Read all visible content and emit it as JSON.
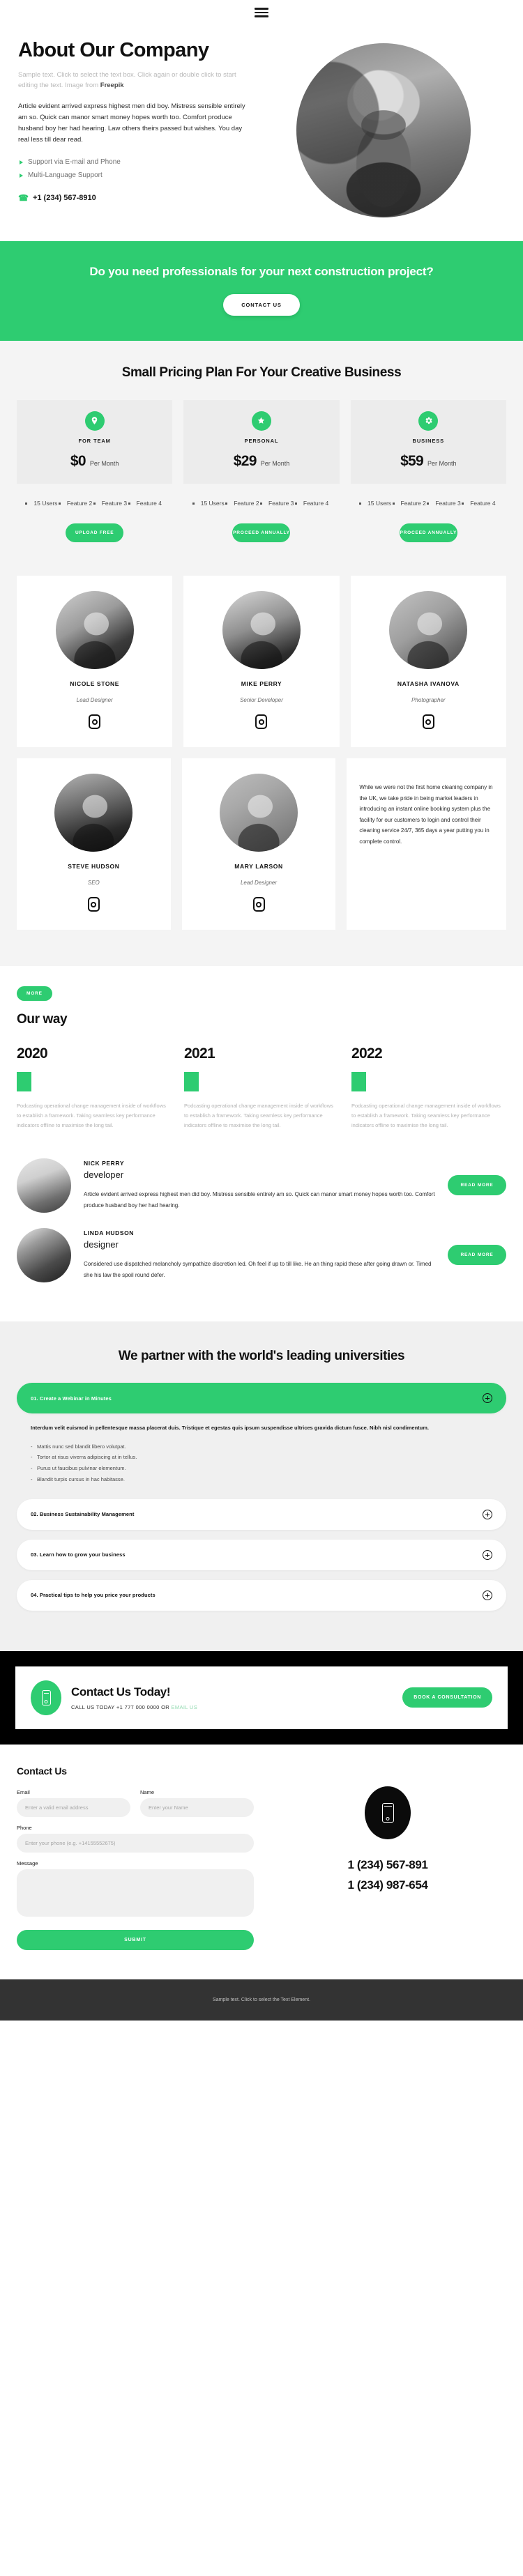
{
  "colors": {
    "accent": "#2ecc71",
    "dark": "#000000",
    "footer_bg": "#333333",
    "muted": "#b3b3b3"
  },
  "topbar": {
    "menu_icon": "hamburger-menu-icon"
  },
  "about": {
    "title": "About Our Company",
    "sample_note_text": "Sample text. Click to select the text box. Click again or double click to start editing the text. Image from ",
    "sample_note_link": "Freepik",
    "body": "Article evident arrived express highest men did boy. Mistress sensible entirely am so. Quick can manor smart money hopes worth too. Comfort produce husband boy her had hearing. Law others theirs passed but wishes. You day real less till dear read.",
    "features": [
      "Support via E-mail and Phone",
      "Multi-Language Support"
    ],
    "phone": "+1 (234) 567-8910",
    "phone_icon": "phone-icon",
    "portrait_alt": "portrait-photo"
  },
  "cta": {
    "heading": "Do you need professionals for your next construction project?",
    "button": "CONTACT US"
  },
  "pricing": {
    "title": "Small Pricing Plan For Your Creative Business",
    "plans": [
      {
        "icon": "location-pin-icon",
        "icon_glyph": "•",
        "name": "FOR TEAM",
        "price": "$0",
        "period": "Per Month",
        "features": [
          "15 Users",
          "Feature 2",
          "Feature 3",
          "Feature 4"
        ],
        "button": "UPLOAD FREE"
      },
      {
        "icon": "star-badge-icon",
        "icon_glyph": "★",
        "name": "PERSONAL",
        "price": "$29",
        "period": "Per Month",
        "features": [
          "15 Users",
          "Feature 2",
          "Feature 3",
          "Feature 4"
        ],
        "button": "PROCEED ANNUALLY"
      },
      {
        "icon": "gear-icon",
        "icon_glyph": "⚙",
        "name": "BUSINESS",
        "price": "$59",
        "period": "Per Month",
        "features": [
          "15 Users",
          "Feature 2",
          "Feature 3",
          "Feature 4"
        ],
        "button": "PROCEED ANNUALLY"
      }
    ]
  },
  "team": {
    "row1": [
      {
        "name": "NICOLE STONE",
        "role": "Lead Designer",
        "social_icon": "instagram-icon"
      },
      {
        "name": "MIKE PERRY",
        "role": "Senior Developer",
        "social_icon": "instagram-icon"
      },
      {
        "name": "NATASHA IVANOVA",
        "role": "Photographer",
        "social_icon": "instagram-icon"
      }
    ],
    "row2": [
      {
        "name": "STEVE HUDSON",
        "role": "SEO",
        "social_icon": "instagram-icon"
      },
      {
        "name": "MARY LARSON",
        "role": "Lead Designer",
        "social_icon": "instagram-icon"
      }
    ],
    "testimonial": "While we were not the first home cleaning company in the UK, we take pride in being market leaders in introducing an instant online booking system plus the facility for our customers to login and control their cleaning service 24/7, 365 days a year putting you in complete control."
  },
  "ourway": {
    "badge": "MORE",
    "title": "Our way",
    "items": [
      {
        "year": "2020",
        "text": "Podcasting operational change management inside of workflows to establish a framework. Taking seamless key performance indicators offline to maximise the long tail."
      },
      {
        "year": "2021",
        "text": "Podcasting operational change management inside of workflows to establish a framework. Taking seamless key performance indicators offline to maximise the long tail."
      },
      {
        "year": "2022",
        "text": "Podcasting operational change management inside of workflows to establish a framework. Taking seamless key performance indicators offline to maximise the long tail."
      }
    ]
  },
  "posts": [
    {
      "name": "NICK PERRY",
      "role": "developer",
      "text": "Article evident arrived express highest men did boy. Mistress sensible entirely am so. Quick can manor smart money hopes worth too. Comfort produce husband boy her had hearing.",
      "button": "READ MORE"
    },
    {
      "name": "LINDA HUDSON",
      "role": "designer",
      "text": "Considered use dispatched melancholy sympathize discretion led. Oh feel if up to till like. He an thing rapid these after going drawn or. Timed she his law the spoil round defer.",
      "button": "READ MORE"
    }
  ],
  "partners": {
    "title": "We partner with the world's leading universities",
    "items": [
      {
        "title": "01. Create a Webinar in Minutes",
        "open": true,
        "lead": "Interdum velit euismod in pellentesque massa placerat duis. Tristique et egestas quis ipsum suspendisse ultrices gravida dictum fusce. Nibh nisl condimentum.",
        "bullets": [
          "Mattis nunc sed blandit libero volutpat.",
          "Tortor at risus viverra adipiscing at in tellus.",
          "Purus ut faucibus pulvinar elementum.",
          "Blandit turpis cursus in hac habitasse."
        ]
      },
      {
        "title": "02. Business Sustainability Management",
        "open": false
      },
      {
        "title": "03. Learn how to grow your business",
        "open": false
      },
      {
        "title": "04. Practical tips to help you price your products",
        "open": false
      }
    ]
  },
  "band": {
    "icon": "mobile-phone-icon",
    "heading": "Contact Us Today!",
    "sub_prefix": "CALL US TODAY +1 777 000 0000 OR ",
    "sub_link": "EMAIL US",
    "button": "BOOK A CONSULTATION"
  },
  "contact": {
    "title": "Contact Us",
    "email_label": "Email",
    "email_placeholder": "Enter a valid email address",
    "name_label": "Name",
    "name_placeholder": "Enter your Name",
    "phone_label": "Phone",
    "phone_placeholder": "Enter your phone (e.g. +14155552675)",
    "message_label": "Message",
    "message_placeholder": "",
    "submit": "SUBMIT",
    "icon": "mobile-phone-icon",
    "number1": "1 (234) 567-891",
    "number2": "1 (234) 987-654"
  },
  "footer": {
    "text": "Sample text. Click to select the Text Element."
  }
}
